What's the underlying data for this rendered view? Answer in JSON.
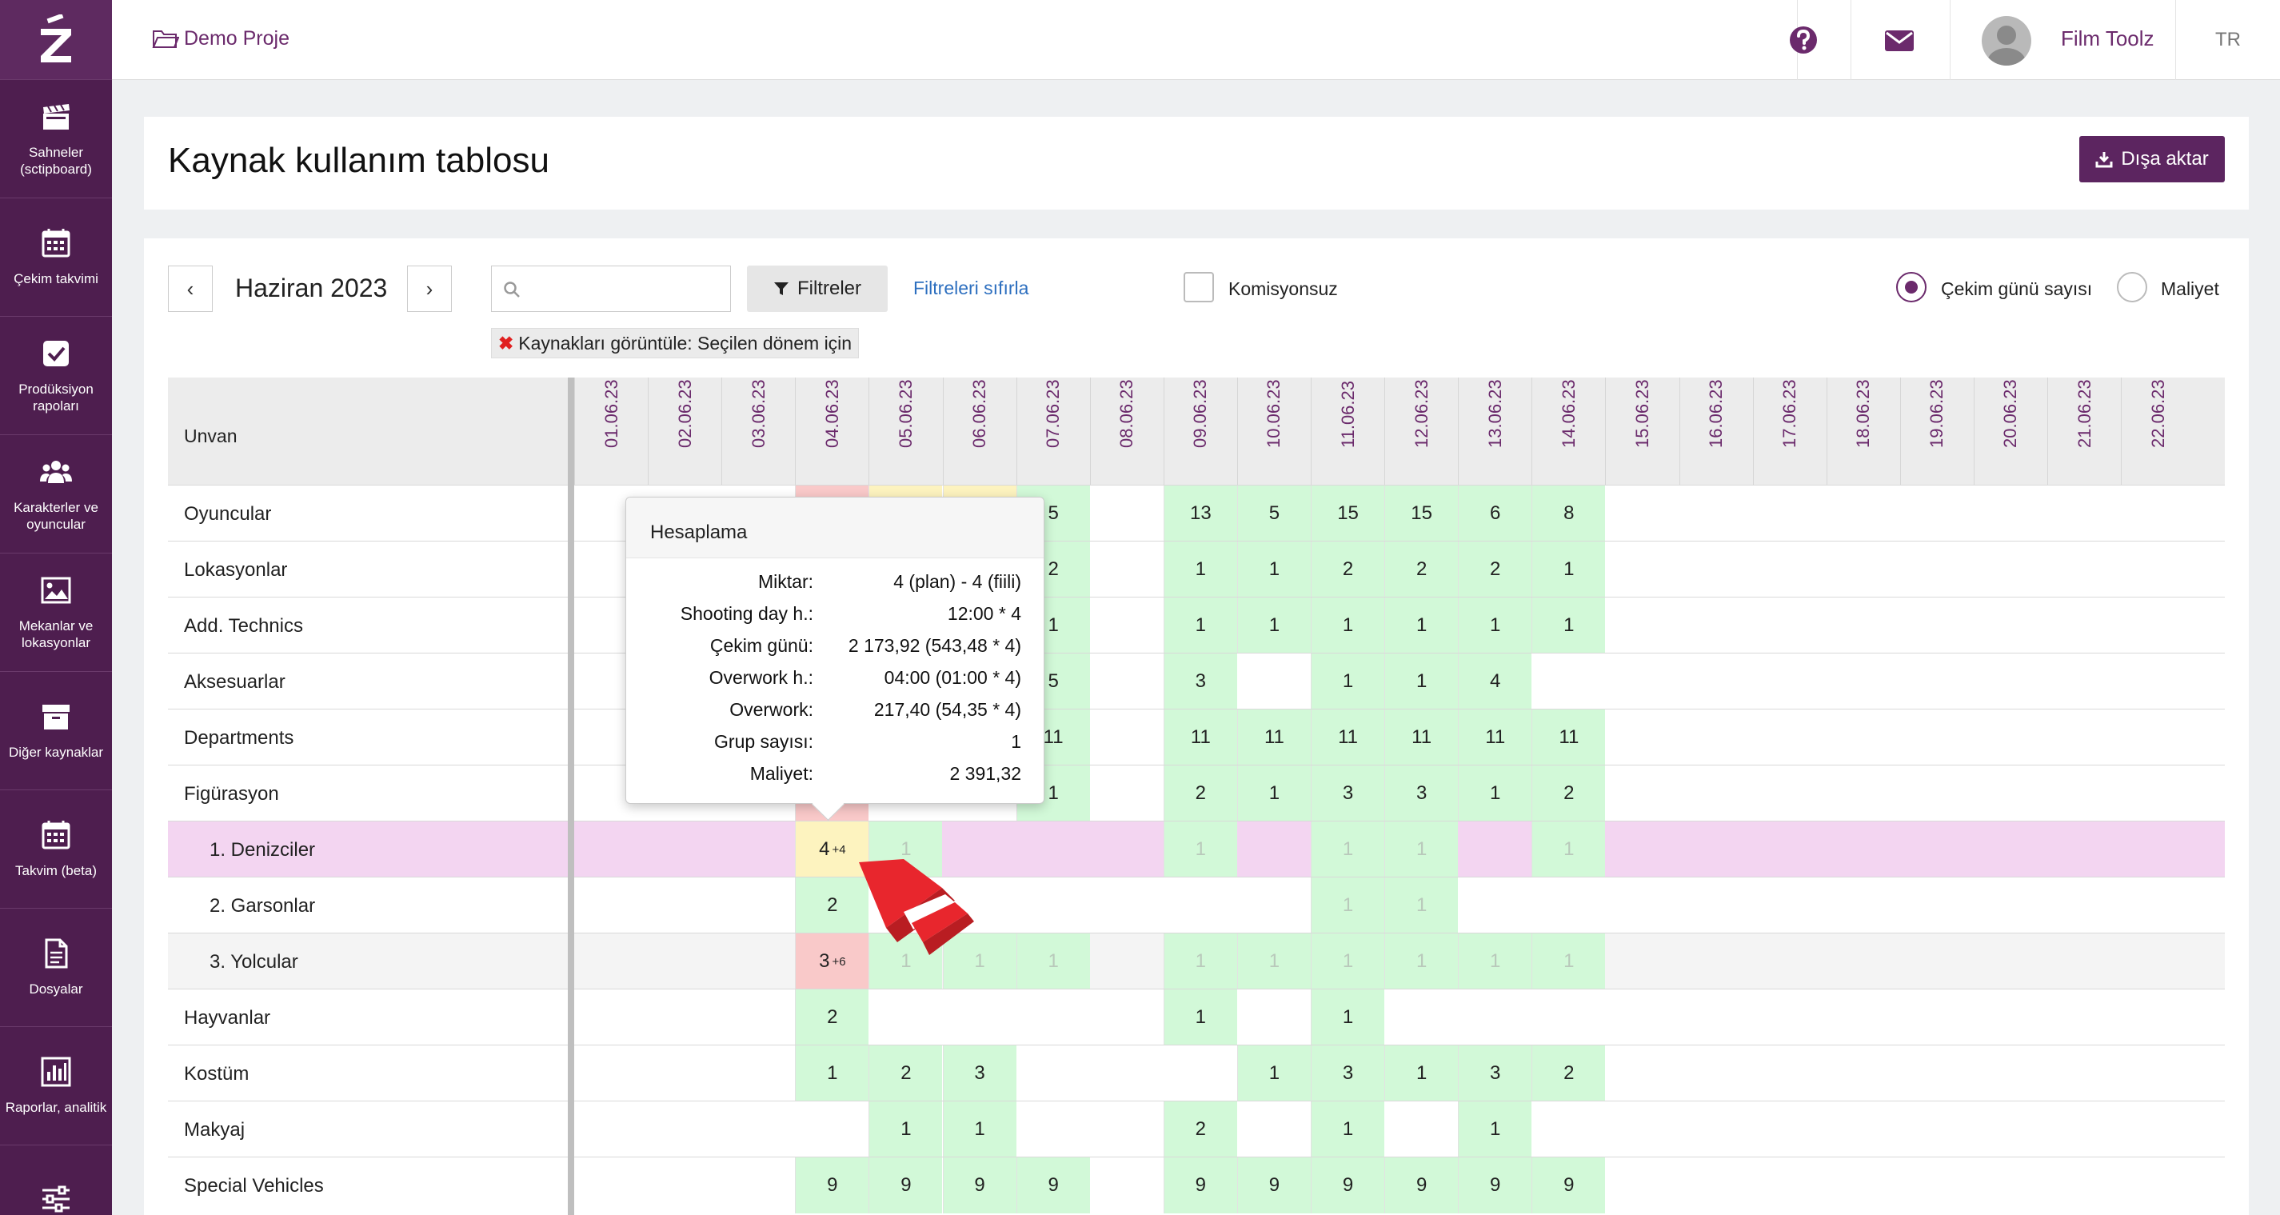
{
  "app": {
    "brand_letter": "Z"
  },
  "sidebar": {
    "items": [
      {
        "label": "Sahneler (sctipboard)",
        "icon": "clapperboard-icon"
      },
      {
        "label": "Çekim takvimi",
        "icon": "calendar-icon"
      },
      {
        "label": "Prodüksiyon rapoları",
        "icon": "checkbox-icon"
      },
      {
        "label": "Karakterler ve oyuncular",
        "icon": "users-icon"
      },
      {
        "label": "Mekanlar ve lokasyonlar",
        "icon": "image-icon"
      },
      {
        "label": "Diğer kaynaklar",
        "icon": "archive-icon"
      },
      {
        "label": "Takvim (beta)",
        "icon": "calendar-icon"
      },
      {
        "label": "Dosyalar",
        "icon": "file-icon"
      },
      {
        "label": "Raporlar, analitik",
        "icon": "chart-icon"
      },
      {
        "label": "",
        "icon": "sliders-icon"
      }
    ]
  },
  "topbar": {
    "project": "Demo Proje",
    "user": "Film Toolz",
    "lang": "TR"
  },
  "page": {
    "title": "Kaynak kullanım tablosu",
    "export_label": "Dışa aktar"
  },
  "toolbar": {
    "prev": "‹",
    "next": "›",
    "month": "Haziran 2023",
    "search_placeholder": "",
    "filter_label": "Filtreler",
    "reset_label": "Filtreleri sıfırla",
    "checkbox_label": "Komisyonsuz",
    "radio1_label": "Çekim günü sayısı",
    "radio2_label": "Maliyet",
    "tag_label": "Kaynakları görüntüle:  Seçilen dönem için",
    "tag_x": "✖"
  },
  "grid": {
    "header_label": "Unvan",
    "dates": [
      "01.06.23",
      "02.06.23",
      "03.06.23",
      "04.06.23",
      "05.06.23",
      "06.06.23",
      "07.06.23",
      "08.06.23",
      "09.06.23",
      "10.06.23",
      "11.06.23",
      "12.06.23",
      "13.06.23",
      "14.06.23",
      "15.06.23",
      "16.06.23",
      "17.06.23",
      "18.06.23",
      "19.06.23",
      "20.06.23",
      "21.06.23",
      "22.06.23"
    ],
    "rows": [
      {
        "label": "Oyuncular",
        "indent": 0,
        "bg": "",
        "cells": [
          [
            "",
            ""
          ],
          [
            "",
            ""
          ],
          [
            "",
            ""
          ],
          [
            "r",
            ""
          ],
          [
            "y",
            ""
          ],
          [
            "y",
            ""
          ],
          [
            "g",
            "5"
          ],
          [
            "",
            ""
          ],
          [
            "g",
            "13"
          ],
          [
            "g",
            "5"
          ],
          [
            "g",
            "15"
          ],
          [
            "g",
            "15"
          ],
          [
            "g",
            "6"
          ],
          [
            "g",
            "8"
          ]
        ]
      },
      {
        "label": "Lokasyonlar",
        "indent": 0,
        "bg": "",
        "cells": [
          [
            "",
            ""
          ],
          [
            "",
            ""
          ],
          [
            "",
            ""
          ],
          [
            "",
            ""
          ],
          [
            "",
            ""
          ],
          [
            "",
            ""
          ],
          [
            "g",
            "2"
          ],
          [
            "",
            ""
          ],
          [
            "g",
            "1"
          ],
          [
            "g",
            "1"
          ],
          [
            "g",
            "2"
          ],
          [
            "g",
            "2"
          ],
          [
            "g",
            "2"
          ],
          [
            "g",
            "1"
          ]
        ]
      },
      {
        "label": "Add. Technics",
        "indent": 0,
        "bg": "",
        "cells": [
          [
            "",
            ""
          ],
          [
            "",
            ""
          ],
          [
            "",
            ""
          ],
          [
            "",
            ""
          ],
          [
            "",
            ""
          ],
          [
            "",
            ""
          ],
          [
            "g",
            "1"
          ],
          [
            "",
            ""
          ],
          [
            "g",
            "1"
          ],
          [
            "g",
            "1"
          ],
          [
            "g",
            "1"
          ],
          [
            "g",
            "1"
          ],
          [
            "g",
            "1"
          ],
          [
            "g",
            "1"
          ]
        ]
      },
      {
        "label": "Aksesuarlar",
        "indent": 0,
        "bg": "",
        "cells": [
          [
            "",
            ""
          ],
          [
            "",
            ""
          ],
          [
            "",
            ""
          ],
          [
            "",
            ""
          ],
          [
            "",
            ""
          ],
          [
            "",
            ""
          ],
          [
            "g",
            "5"
          ],
          [
            "",
            ""
          ],
          [
            "g",
            "3"
          ],
          [
            "",
            ""
          ],
          [
            "g",
            "1"
          ],
          [
            "g",
            "1"
          ],
          [
            "g",
            "4"
          ],
          [
            "",
            ""
          ]
        ]
      },
      {
        "label": "Departments",
        "indent": 0,
        "bg": "",
        "cells": [
          [
            "",
            ""
          ],
          [
            "",
            ""
          ],
          [
            "",
            ""
          ],
          [
            "",
            ""
          ],
          [
            "",
            ""
          ],
          [
            "",
            ""
          ],
          [
            "g",
            "11"
          ],
          [
            "",
            ""
          ],
          [
            "g",
            "11"
          ],
          [
            "g",
            "11"
          ],
          [
            "g",
            "11"
          ],
          [
            "g",
            "11"
          ],
          [
            "g",
            "11"
          ],
          [
            "g",
            "11"
          ]
        ]
      },
      {
        "label": "Figürasyon",
        "indent": 0,
        "bg": "",
        "cells": [
          [
            "",
            ""
          ],
          [
            "",
            ""
          ],
          [
            "",
            ""
          ],
          [
            "r",
            ""
          ],
          [
            "",
            ""
          ],
          [
            "",
            ""
          ],
          [
            "g",
            "1"
          ],
          [
            "",
            ""
          ],
          [
            "g",
            "2"
          ],
          [
            "g",
            "1"
          ],
          [
            "g",
            "3"
          ],
          [
            "g",
            "3"
          ],
          [
            "g",
            "1"
          ],
          [
            "g",
            "2"
          ]
        ]
      },
      {
        "label": "1. Denizciler",
        "indent": 1,
        "bg": "pk",
        "cells": [
          [
            "",
            ""
          ],
          [
            "",
            ""
          ],
          [
            "",
            ""
          ],
          [
            "y",
            "4",
            "+4"
          ],
          [
            "gf",
            "1"
          ],
          [
            "",
            ""
          ],
          [
            "",
            ""
          ],
          [
            "",
            ""
          ],
          [
            "gf",
            "1"
          ],
          [
            "",
            ""
          ],
          [
            "gf",
            "1"
          ],
          [
            "gf",
            "1"
          ],
          [
            "",
            ""
          ],
          [
            "gf",
            "1"
          ]
        ]
      },
      {
        "label": "2. Garsonlar",
        "indent": 1,
        "bg": "",
        "cells": [
          [
            "",
            ""
          ],
          [
            "",
            ""
          ],
          [
            "",
            ""
          ],
          [
            "g",
            "2"
          ],
          [
            "",
            ""
          ],
          [
            "",
            ""
          ],
          [
            "",
            ""
          ],
          [
            "",
            ""
          ],
          [
            "",
            ""
          ],
          [
            "",
            ""
          ],
          [
            "gf",
            "1"
          ],
          [
            "gf",
            "1"
          ],
          [
            "",
            ""
          ],
          [
            "",
            ""
          ]
        ]
      },
      {
        "label": "3. Yolcular",
        "indent": 1,
        "bg": "grey",
        "cells": [
          [
            "",
            ""
          ],
          [
            "",
            ""
          ],
          [
            "",
            ""
          ],
          [
            "r",
            "3",
            "+6"
          ],
          [
            "gf",
            "1"
          ],
          [
            "gf",
            "1"
          ],
          [
            "gf",
            "1"
          ],
          [
            "",
            ""
          ],
          [
            "gf",
            "1"
          ],
          [
            "gf",
            "1"
          ],
          [
            "gf",
            "1"
          ],
          [
            "gf",
            "1"
          ],
          [
            "gf",
            "1"
          ],
          [
            "gf",
            "1"
          ]
        ]
      },
      {
        "label": "Hayvanlar",
        "indent": 0,
        "bg": "",
        "cells": [
          [
            "",
            ""
          ],
          [
            "",
            ""
          ],
          [
            "",
            ""
          ],
          [
            "g",
            "2"
          ],
          [
            "",
            ""
          ],
          [
            "",
            ""
          ],
          [
            "",
            ""
          ],
          [
            "",
            ""
          ],
          [
            "g",
            "1"
          ],
          [
            "",
            ""
          ],
          [
            "g",
            "1"
          ],
          [
            "",
            ""
          ],
          [
            "",
            ""
          ],
          [
            "",
            ""
          ]
        ]
      },
      {
        "label": "Kostüm",
        "indent": 0,
        "bg": "",
        "cells": [
          [
            "",
            ""
          ],
          [
            "",
            ""
          ],
          [
            "",
            ""
          ],
          [
            "g",
            "1"
          ],
          [
            "g",
            "2"
          ],
          [
            "g",
            "3"
          ],
          [
            "",
            ""
          ],
          [
            "",
            ""
          ],
          [
            "",
            ""
          ],
          [
            "g",
            "1"
          ],
          [
            "g",
            "3"
          ],
          [
            "g",
            "1"
          ],
          [
            "g",
            "3"
          ],
          [
            "g",
            "2"
          ]
        ]
      },
      {
        "label": "Makyaj",
        "indent": 0,
        "bg": "",
        "cells": [
          [
            "",
            ""
          ],
          [
            "",
            ""
          ],
          [
            "",
            ""
          ],
          [
            "",
            ""
          ],
          [
            "g",
            "1"
          ],
          [
            "g",
            "1"
          ],
          [
            "",
            ""
          ],
          [
            "",
            ""
          ],
          [
            "g",
            "2"
          ],
          [
            "",
            ""
          ],
          [
            "g",
            "1"
          ],
          [
            "",
            ""
          ],
          [
            "g",
            "1"
          ],
          [
            "",
            ""
          ]
        ]
      },
      {
        "label": "Special Vehicles",
        "indent": 0,
        "bg": "",
        "cells": [
          [
            "",
            ""
          ],
          [
            "",
            ""
          ],
          [
            "",
            ""
          ],
          [
            "g",
            "9"
          ],
          [
            "g",
            "9"
          ],
          [
            "g",
            "9"
          ],
          [
            "g",
            "9"
          ],
          [
            "",
            ""
          ],
          [
            "g",
            "9"
          ],
          [
            "g",
            "9"
          ],
          [
            "g",
            "9"
          ],
          [
            "g",
            "9"
          ],
          [
            "g",
            "9"
          ],
          [
            "g",
            "9"
          ]
        ]
      }
    ]
  },
  "tooltip": {
    "title": "Hesaplama",
    "rows": [
      {
        "k": "Miktar:",
        "v": "4 (plan) - 4 (fiili)"
      },
      {
        "k": "Shooting day h.:",
        "v": "12:00 * 4"
      },
      {
        "k": "Çekim günü:",
        "v": "2 173,92 (543,48 * 4)"
      },
      {
        "k": "Overwork h.:",
        "v": "04:00 (01:00 * 4)"
      },
      {
        "k": "Overwork:",
        "v": "217,40 (54,35 * 4)"
      },
      {
        "k": "Grup sayısı:",
        "v": "1"
      },
      {
        "k": "Maliyet:",
        "v": "2 391,32"
      }
    ]
  },
  "colors": {
    "brand": "#4e1e4f",
    "accent": "#6b2a6c",
    "green": "#d2f9d8",
    "red": "#f9c9c9",
    "yellow": "#fdf3bf",
    "pink": "#f3d5f1"
  }
}
